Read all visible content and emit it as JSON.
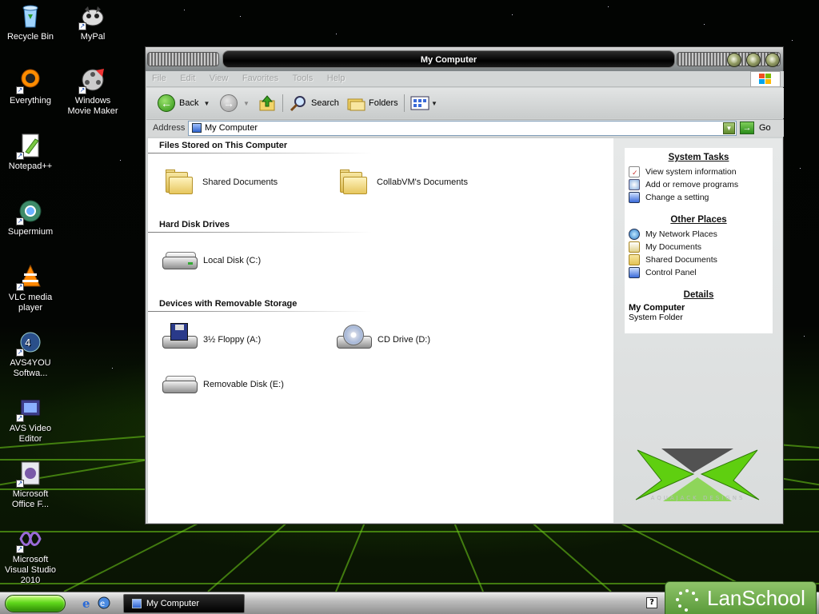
{
  "desktop": {
    "icons": [
      {
        "label": "Recycle Bin",
        "icon": "recycle-bin-icon"
      },
      {
        "label": "MyPal",
        "icon": "mypal-icon"
      },
      {
        "label": "Everything",
        "icon": "everything-icon"
      },
      {
        "label": "Windows Movie Maker",
        "icon": "movie-maker-icon"
      },
      {
        "label": "Notepad++",
        "icon": "notepadpp-icon"
      },
      {
        "label": "Supermium",
        "icon": "supermium-icon"
      },
      {
        "label": "VLC media player",
        "icon": "vlc-icon"
      },
      {
        "label": "AVS4YOU Softwa...",
        "icon": "avs4you-icon"
      },
      {
        "label": "AVS Video Editor",
        "icon": "avs-video-editor-icon"
      },
      {
        "label": "Microsoft Office F...",
        "icon": "office-icon"
      },
      {
        "label": "Microsoft Visual Studio 2010",
        "icon": "visual-studio-icon"
      }
    ]
  },
  "window": {
    "title": "My Computer",
    "menu": [
      "File",
      "Edit",
      "View",
      "Favorites",
      "Tools",
      "Help"
    ],
    "toolbar": {
      "back": "Back",
      "search": "Search",
      "folders": "Folders"
    },
    "address": {
      "label": "Address",
      "value": "My Computer",
      "go": "Go"
    },
    "groups": {
      "files_stored": {
        "title": "Files Stored on This Computer",
        "items": [
          "Shared Documents",
          "CollabVM's Documents"
        ]
      },
      "hard_disks": {
        "title": "Hard Disk Drives",
        "items": [
          "Local Disk (C:)"
        ]
      },
      "removable": {
        "title": "Devices with Removable Storage",
        "items": [
          "3½ Floppy (A:)",
          "CD Drive (D:)",
          "Removable Disk (E:)"
        ]
      }
    },
    "sidepane": {
      "system_tasks": {
        "title": "System Tasks",
        "links": [
          "View system information",
          "Add or remove programs",
          "Change a setting"
        ]
      },
      "other_places": {
        "title": "Other Places",
        "links": [
          "My Network Places",
          "My Documents",
          "Shared Documents",
          "Control Panel"
        ]
      },
      "details": {
        "title": "Details",
        "name": "My Computer",
        "type": "System Folder"
      },
      "brand_text": "AQUAJACK DESIGNS"
    }
  },
  "taskbar": {
    "task_button": "My Computer",
    "tray_help": "?",
    "lanschool": "LanSchool"
  },
  "colors": {
    "accent_green": "#5fd61b",
    "titlebar_black": "#000000",
    "side_pane_bg": "#e6e8e8"
  }
}
